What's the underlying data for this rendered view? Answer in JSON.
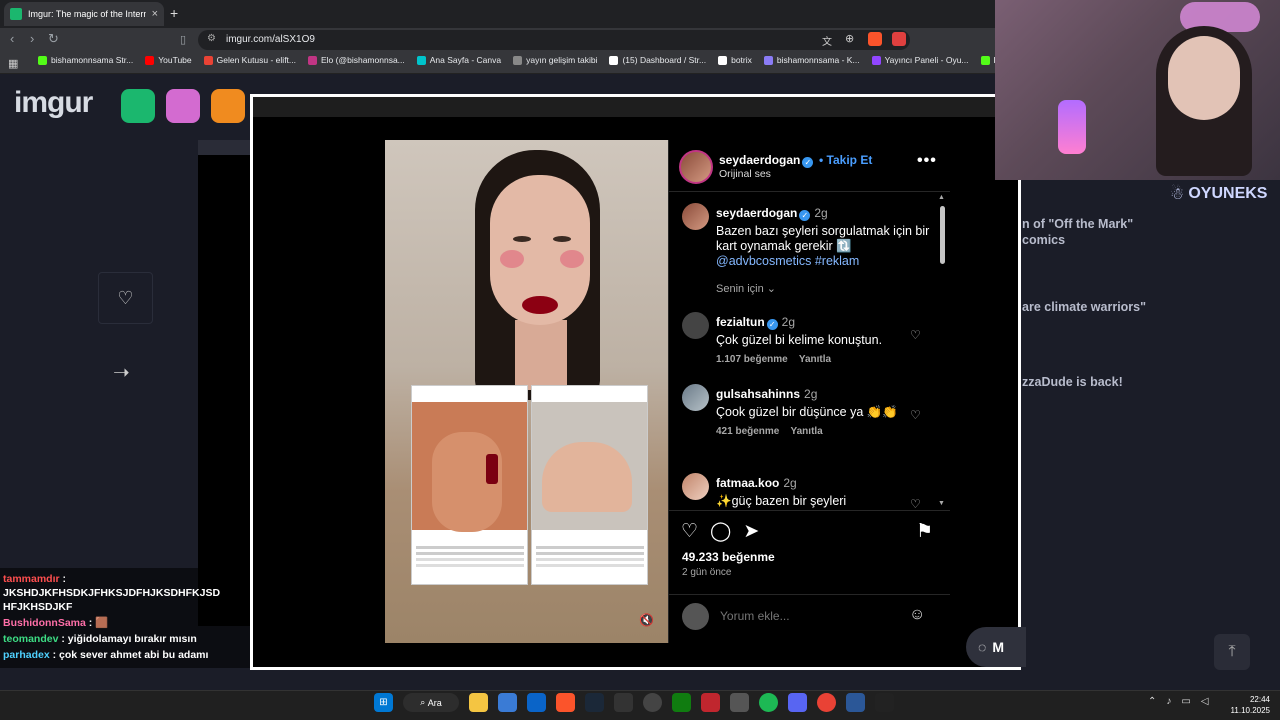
{
  "browser": {
    "tab_title": "Imgur: The magic of the Internet",
    "url": "imgur.com/alSX1O9",
    "bookmarks": [
      {
        "label": "bishamonnsama Str...",
        "color": "#53fc18"
      },
      {
        "label": "YouTube",
        "color": "#ff0000"
      },
      {
        "label": "Gelen Kutusu - elift...",
        "color": "#ea4335"
      },
      {
        "label": "Elo (@bishamonnsa...",
        "color": "#c13584"
      },
      {
        "label": "Ana Sayfa - Canva",
        "color": "#00c4cc"
      },
      {
        "label": "yayın gelişim takibi",
        "color": "#888888"
      },
      {
        "label": "(15) Dashboard / Str...",
        "color": "#ffffff"
      },
      {
        "label": "botrix",
        "color": "#ffffff"
      },
      {
        "label": "bishamonnsama - K...",
        "color": "#8b7cf6"
      },
      {
        "label": "Yayıncı Paneli - Oyu...",
        "color": "#9146ff"
      },
      {
        "label": "KickLogz - K...",
        "color": "#53fc18"
      }
    ]
  },
  "imgur": {
    "logo": "imgur",
    "right_posts": [
      "n of \"Off the Mark\" comics",
      "are climate warriors\"",
      "zzaDude is back!"
    ],
    "messenger_label": "M"
  },
  "post": {
    "username": "seydaerdogan",
    "follow": "Takip Et",
    "audio": "Orijinal ses",
    "caption": {
      "user": "seydaerdogan",
      "time": "2g",
      "text": "Bazen bazı şeyleri sorgulatmak için bir kart oynamak gerekir 🔃",
      "link": "@advbcosmetics #reklam"
    },
    "for_you": "Senin için",
    "comments": [
      {
        "user": "fezialtun",
        "verified": true,
        "time": "2g",
        "text": "Çok güzel bi kelime konuştun.",
        "likes": "1.107 beğenme",
        "reply": "Yanıtla"
      },
      {
        "user": "gulsahsahinns",
        "verified": false,
        "time": "2g",
        "text": "Çook güzel bir düşünce ya 👏👏",
        "likes": "421 beğenme",
        "reply": "Yanıtla"
      },
      {
        "user": "fatmaa.koo",
        "verified": false,
        "time": "2g",
        "text": "✨güç bazen bir şeyleri",
        "likes": "",
        "reply": ""
      }
    ],
    "like_count": "49.233 beğenme",
    "posted_ago": "2 gün önce",
    "comment_placeholder": "Yorum ekle..."
  },
  "stream": {
    "brand": "OYUNEKS",
    "chat": [
      {
        "user": "tammamdır",
        "color": "#ff4f4f",
        "message": " : JKSHDJKFHSDKJFHKSJDFHJKSDHFKJSD HFJKHSDJKF"
      },
      {
        "user": "BushidonnSama",
        "color": "#ff6fa8",
        "message": " : 🟫"
      },
      {
        "user": "teomandev",
        "color": "#3ddc84",
        "message": " : yiğidolamayı bırakır mısın"
      },
      {
        "user": "parhadex",
        "color": "#4fd1ff",
        "message": " : çok sever ahmet abi bu adamı"
      }
    ]
  },
  "taskbar": {
    "search_label": "Ara",
    "time": "22:44",
    "date": "11.10.2025"
  }
}
